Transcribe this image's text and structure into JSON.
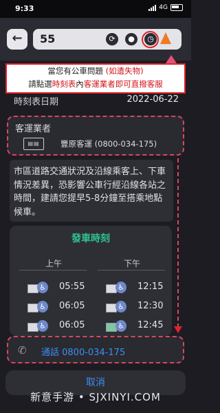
{
  "status_bar": {
    "time": "9:33",
    "network": "4G"
  },
  "search": {
    "query": "55"
  },
  "callout": {
    "line1_pre": "當您有公車問題 ",
    "line1_red": "(如遺失物)",
    "line2_pre": "請點選",
    "line2_red1": "時刻表",
    "line2_mid": "內",
    "line2_red2": "客運業者即可直撥客服"
  },
  "timetable": {
    "date_label": "時刻表日期",
    "date_value": "2022-06-22"
  },
  "operator": {
    "title": "客運業者",
    "name": "豐原客運 (0800-034-175)"
  },
  "notice": "市區道路交通狀況及沿線乘客上、下車情況差異，恐影響公車行經沿線各站之時間，建請您提早5-8分鐘至搭乘地點候車。",
  "schedule": {
    "title": "發車時刻",
    "morning_label": "上午",
    "afternoon_label": "下午",
    "morning_times": [
      "05:55",
      "06:05",
      "06:05"
    ],
    "afternoon_times": [
      "12:15",
      "12:30",
      "12:45"
    ]
  },
  "call_button": {
    "label": "通話 0800-034-175"
  },
  "cancel_button": {
    "label": "取消"
  },
  "watermark": "新意手游 • SJXINYI.COM",
  "colors": {
    "accent_green": "#2fc38f",
    "link_blue": "#3d8ef0",
    "highlight_red": "#e0232b"
  }
}
